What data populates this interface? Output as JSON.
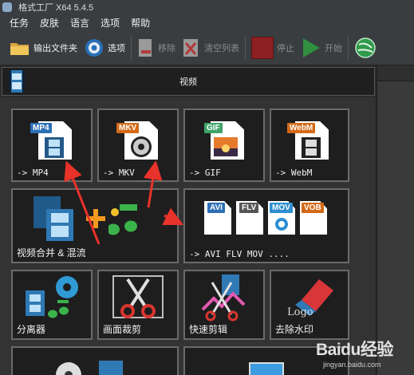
{
  "window": {
    "title": "格式工厂 X64 5.4.5"
  },
  "menu": [
    "任务",
    "皮肤",
    "语言",
    "选项",
    "帮助"
  ],
  "toolbar": {
    "output_folder": "输出文件夹",
    "options": "选项",
    "remove": "移除",
    "clear_list": "清空列表",
    "stop": "停止",
    "start": "开始"
  },
  "category": {
    "label": "视频"
  },
  "tiles": {
    "mp4": {
      "badge": "MP4",
      "label": "-> MP4"
    },
    "mkv": {
      "badge": "MKV",
      "label": "-> MKV"
    },
    "gif": {
      "badge": "GIF",
      "label": "-> GIF"
    },
    "webm": {
      "badge": "WebM",
      "label": "-> WebM"
    },
    "merge": {
      "label": "视频合并 & 混流"
    },
    "multi": {
      "label": "-> AVI FLV MOV ....",
      "badges": [
        "AVI",
        "FLV",
        "MOV",
        "VOB"
      ]
    },
    "separator": {
      "label": "分离器"
    },
    "crop": {
      "label": "画面裁剪"
    },
    "quickcut": {
      "label": "快速剪辑"
    },
    "watermark": {
      "label": "去除水印",
      "logo_text": "Logo"
    }
  },
  "colors": {
    "arrow": "#e8332b",
    "accent_green": "#2fa84f",
    "stop_red": "#c0282d"
  },
  "watermark_text": "Baidu经验",
  "watermark_url": "jingyan.baidu.com"
}
